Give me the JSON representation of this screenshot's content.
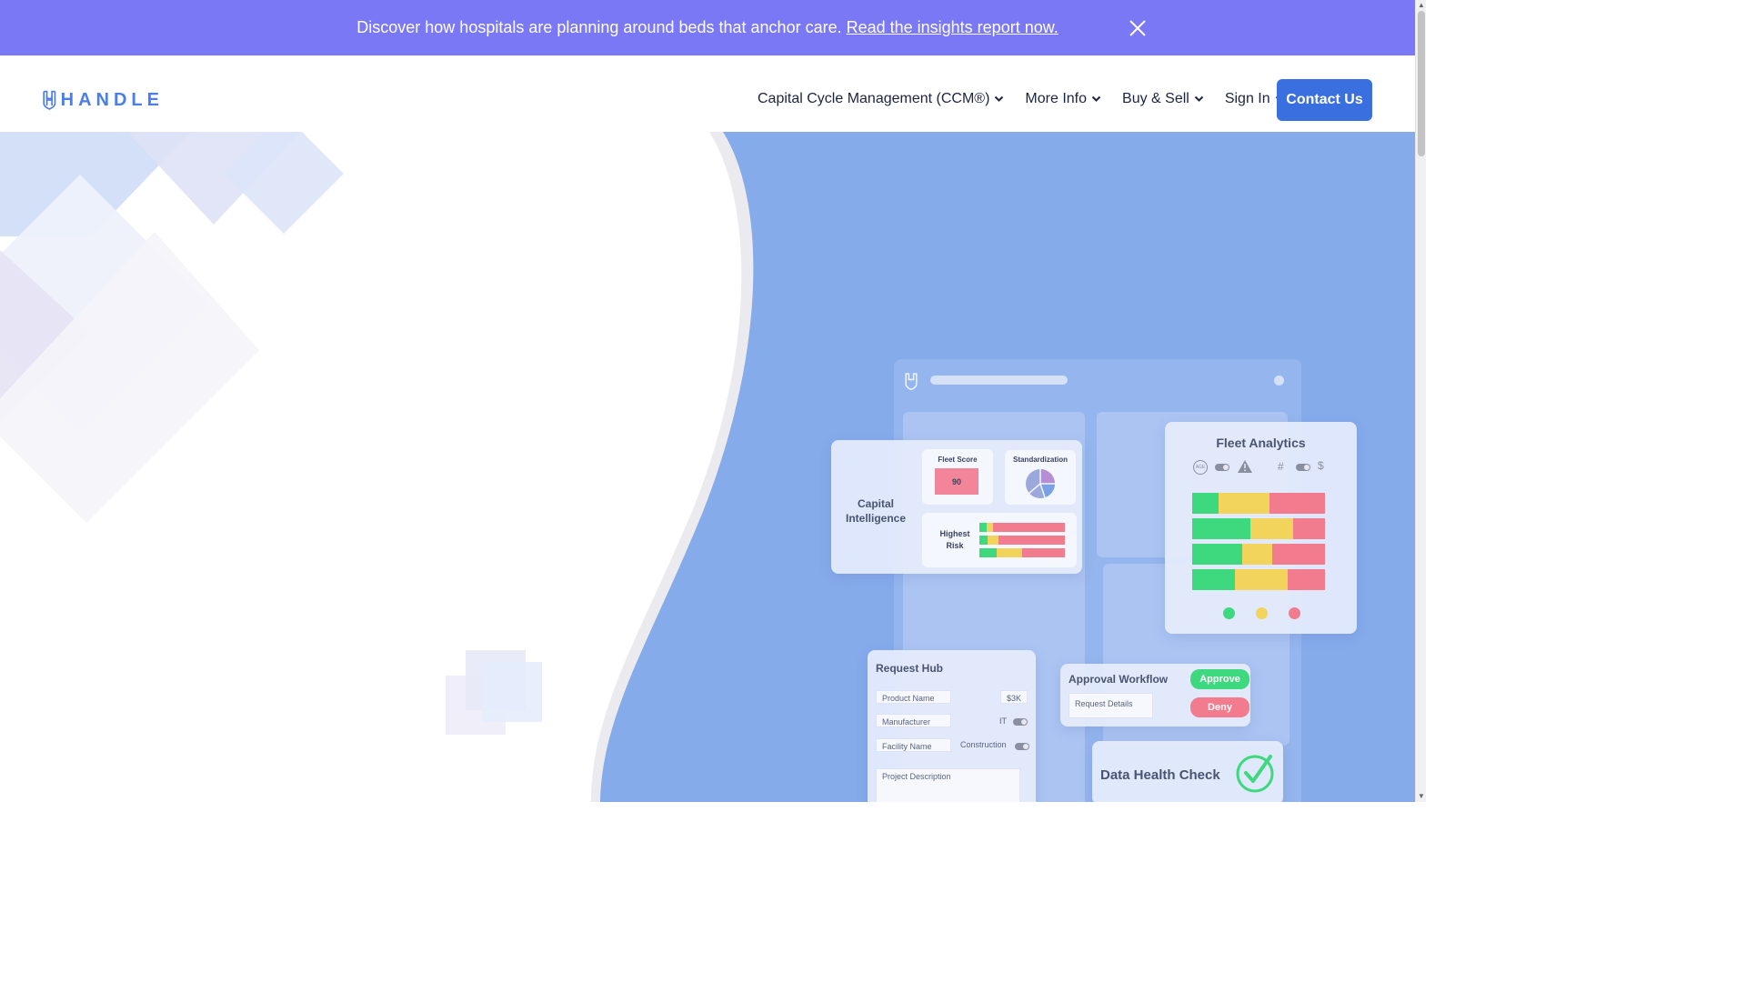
{
  "announcement": {
    "message": "Discover how hospitals are planning around beds that anchor care.",
    "link_text": "Read the insights report now."
  },
  "header": {
    "logo_text": "HANDLE",
    "nav_items": [
      {
        "label": "Capital Cycle Management (CCM®)"
      },
      {
        "label": "More Info"
      },
      {
        "label": "Buy & Sell"
      },
      {
        "label": "Sign In"
      }
    ],
    "contact_label": "Contact Us"
  },
  "dashboard": {
    "capital_intelligence": {
      "title_line1": "Capital",
      "title_line2": "Intelligence",
      "fleet_score_label": "Fleet Score",
      "fleet_score_value": "90",
      "standardization_label": "Standardization",
      "highest_risk_line1": "Highest",
      "highest_risk_line2": "Risk"
    },
    "fleet_analytics": {
      "title": "Fleet Analytics",
      "age_label": "AGE",
      "hash_label": "#",
      "dollar_label": "$",
      "rows": [
        [
          0.2,
          0.38,
          0.42
        ],
        [
          0.44,
          0.32,
          0.24
        ],
        [
          0.38,
          0.22,
          0.4
        ],
        [
          0.32,
          0.4,
          0.28
        ]
      ]
    },
    "request_hub": {
      "title": "Request Hub",
      "product_name": "Product Name",
      "amount": "$3K",
      "manufacturer": "Manufacturer",
      "it_label": "IT",
      "facility_name": "Facility Name",
      "construction_label": "Construction",
      "project_description": "Project Description"
    },
    "approval_workflow": {
      "title": "Approval Workflow",
      "approve": "Approve",
      "deny": "Deny",
      "request_details": "Request Details"
    },
    "data_health": {
      "title": "Data Health Check"
    }
  },
  "colors": {
    "announce_bg": "#7b78f5",
    "brand_blue": "#3a6fe0",
    "hero_blue": "#86abeb",
    "green": "#3ed87e",
    "yellow": "#f2d35c",
    "red": "#f27c8e"
  }
}
